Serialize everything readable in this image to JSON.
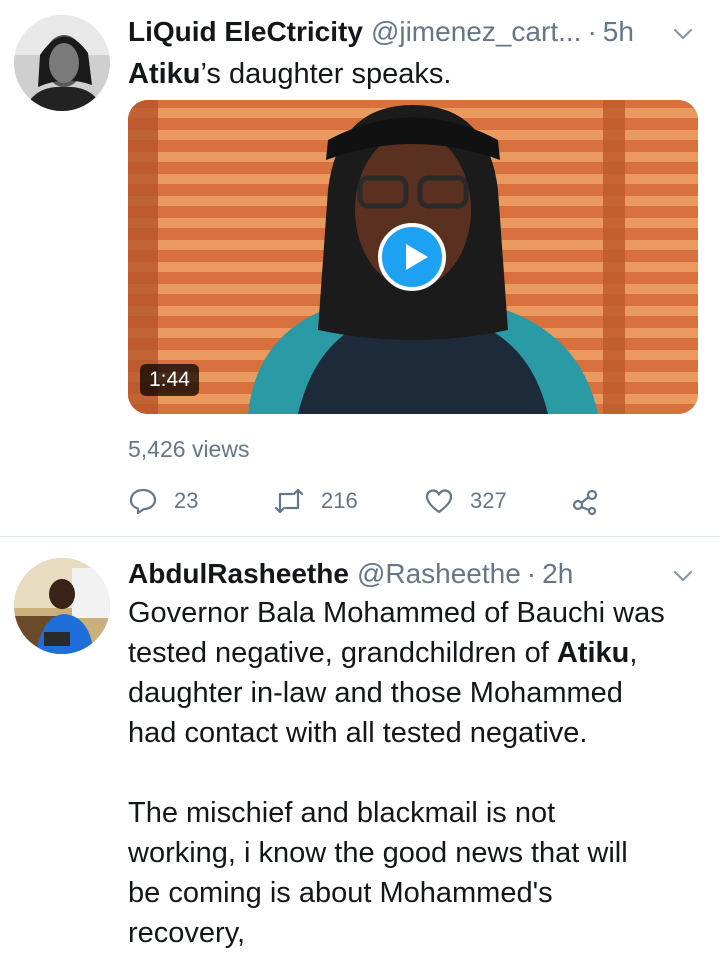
{
  "tweets": [
    {
      "display_name": "LiQuid EleCtricity",
      "handle": "@jimenez_cart...",
      "separator": "·",
      "time": "5h",
      "text_bold": "Atiku",
      "text_rest": "’s daughter speaks.",
      "video_duration": "1:44",
      "views": "5,426 views",
      "replies": "23",
      "retweets": "216",
      "likes": "327"
    },
    {
      "display_name": "AbdulRasheethe",
      "handle": "@Rasheethe",
      "separator": "·",
      "time": "2h",
      "text_p1_a": "Governor Bala Mohammed of Bauchi was",
      "text_p1_b": "tested negative, grandchildren of ",
      "text_p1_bold": "Atiku",
      "text_p1_c": ",",
      "text_p1_d": "daughter in-law and those Mohammed",
      "text_p1_e": "had contact with all tested negative.",
      "text_p2_a": "The mischief and blackmail is not",
      "text_p2_b": "working, i know the good news that will",
      "text_p2_c": "be coming is about Mohammed's",
      "text_p2_d": "recovery,"
    }
  ],
  "colors": {
    "accent": "#1da1f2",
    "secondary_text": "#657786",
    "divider": "#e1e8ed"
  }
}
